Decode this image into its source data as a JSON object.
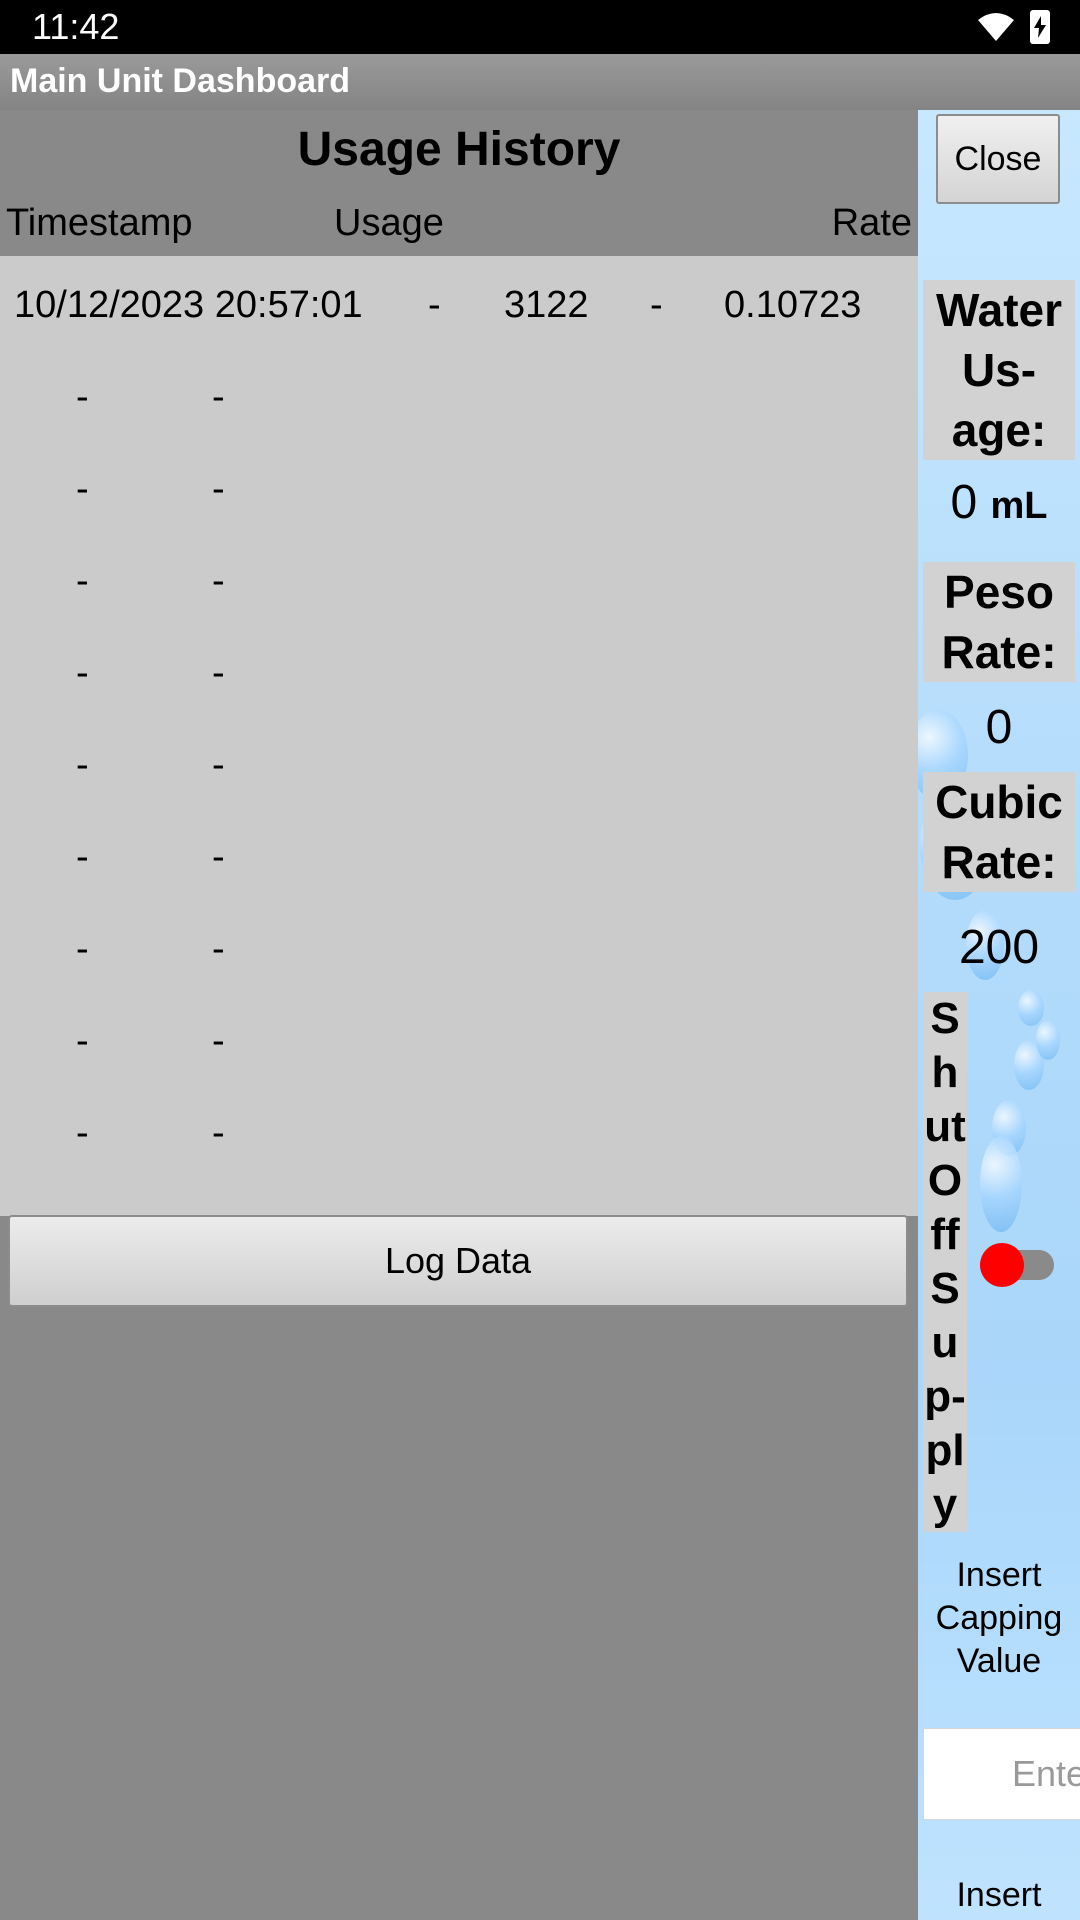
{
  "status_bar": {
    "time": "11:42",
    "icons": [
      "wifi-icon",
      "battery-charging-icon"
    ]
  },
  "app_bar": {
    "title": "Main Unit Dashboard"
  },
  "history": {
    "title": "Usage History",
    "columns": {
      "timestamp": "Timestamp",
      "usage": "Usage",
      "rate": "Rate"
    },
    "first_row": {
      "timestamp": "10/12/2023 20:57:01",
      "sep1": "-",
      "usage": "3122",
      "sep2": "-",
      "rate": "0.10723"
    },
    "empty_rows": [
      {
        "a": "-",
        "b": "-"
      },
      {
        "a": "-",
        "b": "-"
      },
      {
        "a": "-",
        "b": "-"
      },
      {
        "a": "-",
        "b": "-"
      },
      {
        "a": "-",
        "b": "-"
      },
      {
        "a": "-",
        "b": "-"
      },
      {
        "a": "-",
        "b": "-"
      },
      {
        "a": "-",
        "b": "-"
      },
      {
        "a": "-",
        "b": "-"
      }
    ],
    "log_button": "Log Data"
  },
  "side_panel": {
    "close_button": "Close",
    "water_usage_label": "Water Us-age:",
    "water_usage_value": "0",
    "water_usage_unit": "mL",
    "peso_rate_label": "Peso Rate:",
    "peso_rate_value": "0",
    "cubic_rate_label": "Cubic Rate:",
    "cubic_rate_value": "200",
    "shutoff_label": "ShutOffSup-ply",
    "shutoff_enabled": false,
    "capping_label": "Insert Capping Value",
    "capping_placeholder": "Ente",
    "cubic_rate_input_label": "Insert Cubic Rate"
  },
  "colors": {
    "toggle_thumb": "#ff0000",
    "panel_bg": "#b4dcfb",
    "list_bg": "#cbcbcb"
  }
}
